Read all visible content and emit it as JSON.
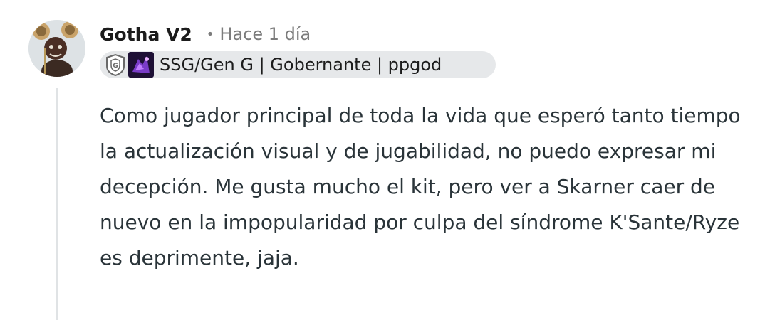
{
  "comment": {
    "username": "Gotha V2",
    "separator": "•",
    "timestamp": "Hace 1 día",
    "flair": {
      "icons": [
        "gen-g-logo-icon",
        "skarner-champion-icon"
      ],
      "text": "SSG/Gen G | Gobernante | ppgod"
    },
    "body": "Como jugador principal de toda la vida que esperó tanto tiempo la actualización visual y de jugabilidad, no puedo expresar mi decepción. Me gusta mucho el kit, pero ver a Skarner caer de nuevo en la impopularidad por culpa del síndrome K'Sante/Ryze es deprimente, jaja."
  },
  "colors": {
    "username": "#1c1c1c",
    "meta": "#7c7c7c",
    "flair_background": "#e6e8ea",
    "body_text": "#2a3439",
    "thread_line": "#e0e3e5"
  }
}
